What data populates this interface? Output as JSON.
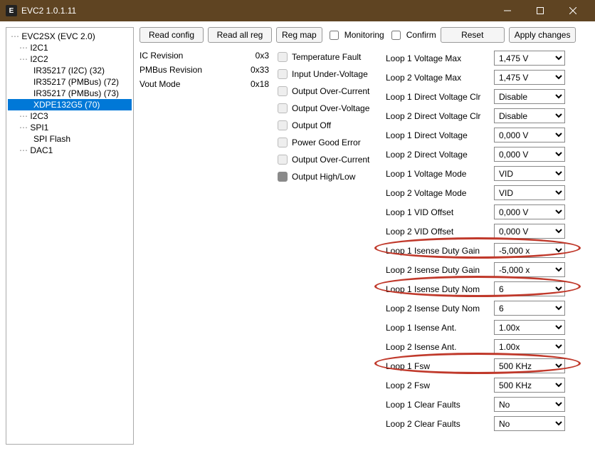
{
  "window": {
    "title": "EVC2 1.0.1.11",
    "icon_letter": "E"
  },
  "tree": {
    "root": "EVC2SX (EVC 2.0)",
    "items": [
      {
        "label": "I2C1",
        "level": 1
      },
      {
        "label": "I2C2",
        "level": 1
      },
      {
        "label": "IR35217 (I2C) (32)",
        "level": 2
      },
      {
        "label": "IR35217 (PMBus) (72)",
        "level": 2
      },
      {
        "label": "IR35217 (PMBus) (73)",
        "level": 2
      },
      {
        "label": "XDPE132G5 (70)",
        "level": 2,
        "selected": true
      },
      {
        "label": "I2C3",
        "level": 1
      },
      {
        "label": "SPI1",
        "level": 1
      },
      {
        "label": "SPI Flash",
        "level": 2
      },
      {
        "label": "DAC1",
        "level": 1
      }
    ]
  },
  "toolbar": {
    "read_config": "Read config",
    "read_all_reg": "Read all reg",
    "reg_map": "Reg map",
    "monitoring": "Monitoring",
    "confirm": "Confirm",
    "reset": "Reset",
    "apply": "Apply changes"
  },
  "info": [
    {
      "label": "IC Revision",
      "value": "0x3"
    },
    {
      "label": "PMBus Revision",
      "value": "0x33"
    },
    {
      "label": "Vout Mode",
      "value": "0x18"
    }
  ],
  "faults": [
    {
      "label": "Temperature Fault",
      "on": false
    },
    {
      "label": "Input Under-Voltage",
      "on": false
    },
    {
      "label": "Output Over-Current",
      "on": false
    },
    {
      "label": "Output Over-Voltage",
      "on": false
    },
    {
      "label": "Output Off",
      "on": false
    },
    {
      "label": "Power Good Error",
      "on": false
    },
    {
      "label": "Output Over-Current",
      "on": false
    },
    {
      "label": "Output High/Low",
      "on": true
    }
  ],
  "settings": [
    {
      "label": "Loop 1 Voltage Max",
      "value": "1,475 V"
    },
    {
      "label": "Loop 2 Voltage Max",
      "value": "1,475 V"
    },
    {
      "label": "Loop 1 Direct Voltage Clr",
      "value": "Disable"
    },
    {
      "label": "Loop 2 Direct Voltage Clr",
      "value": "Disable"
    },
    {
      "label": "Loop 1 Direct Voltage",
      "value": "0,000 V"
    },
    {
      "label": "Loop 2 Direct Voltage",
      "value": "0,000 V"
    },
    {
      "label": "Loop 1 Voltage Mode",
      "value": "VID"
    },
    {
      "label": "Loop 2 Voltage Mode",
      "value": "VID"
    },
    {
      "label": "Loop 1 VID Offset",
      "value": "0,000 V"
    },
    {
      "label": "Loop 2 VID Offset",
      "value": "0,000 V"
    },
    {
      "label": "Loop 1 Isense Duty Gain",
      "value": "-5,000 x",
      "highlight": true
    },
    {
      "label": "Loop 2 Isense Duty Gain",
      "value": "-5,000 x"
    },
    {
      "label": "Loop 1 Isense Duty Nom",
      "value": "6",
      "highlight": true
    },
    {
      "label": "Loop 2 Isense Duty Nom",
      "value": "6"
    },
    {
      "label": "Loop 1 Isense Ant.",
      "value": "1.00x"
    },
    {
      "label": "Loop 2 Isense Ant.",
      "value": "1.00x"
    },
    {
      "label": "Loop 1 Fsw",
      "value": "500 KHz",
      "highlight": true
    },
    {
      "label": "Loop 2 Fsw",
      "value": "500 KHz"
    },
    {
      "label": "Loop 1 Clear Faults",
      "value": "No"
    },
    {
      "label": "Loop 2 Clear Faults",
      "value": "No"
    }
  ]
}
